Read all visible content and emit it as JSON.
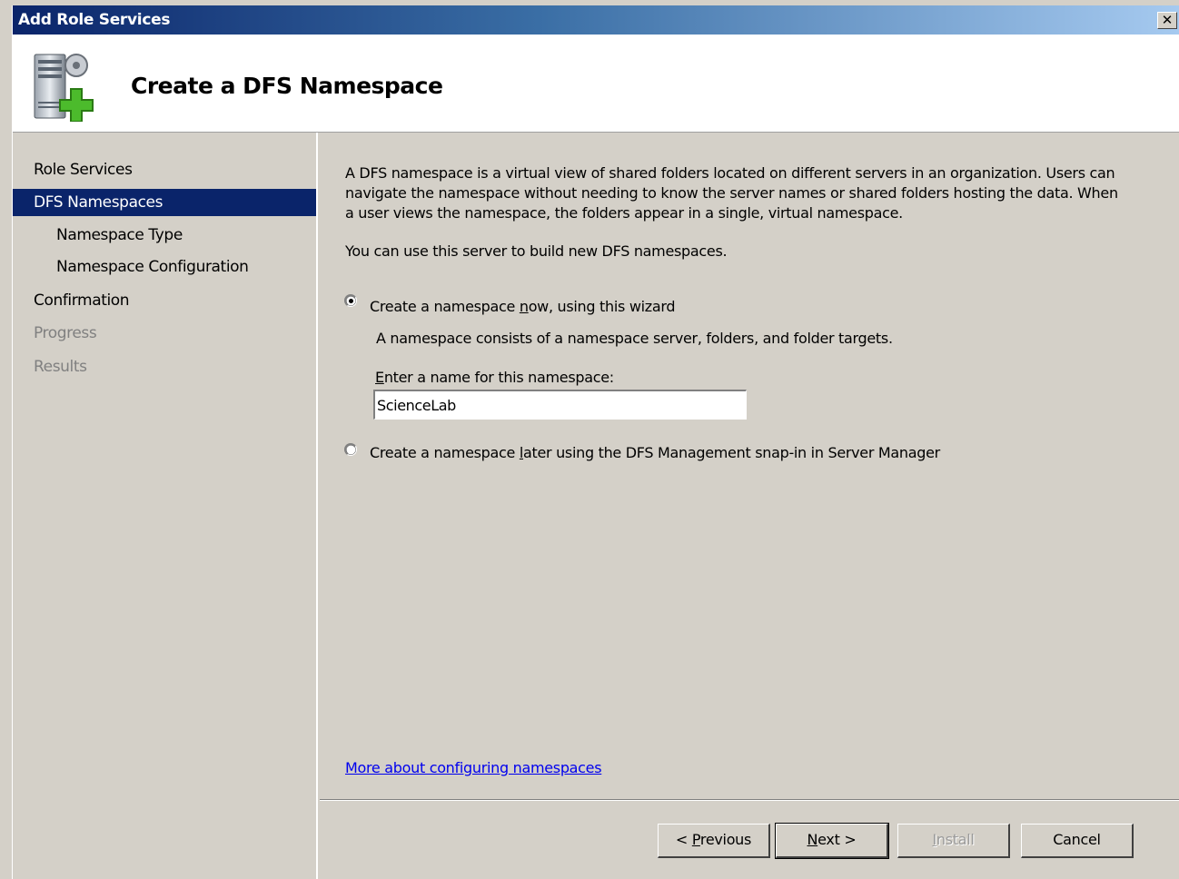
{
  "window": {
    "title": "Add Role Services",
    "close_label": "✕"
  },
  "header": {
    "title": "Create a DFS Namespace",
    "icon": "server-add-icon"
  },
  "nav": {
    "items": [
      {
        "label": "Role Services",
        "state": "normal",
        "level": 0
      },
      {
        "label": "DFS Namespaces",
        "state": "active",
        "level": 0
      },
      {
        "label": "Namespace Type",
        "state": "normal",
        "level": 1
      },
      {
        "label": "Namespace Configuration",
        "state": "normal",
        "level": 1
      },
      {
        "label": "Confirmation",
        "state": "normal",
        "level": 0
      },
      {
        "label": "Progress",
        "state": "disabled",
        "level": 0
      },
      {
        "label": "Results",
        "state": "disabled",
        "level": 0
      }
    ]
  },
  "content": {
    "intro_line1": "A DFS namespace is a virtual view of shared folders located on different servers in an organization. Users can",
    "intro_line2": "navigate the namespace without needing to know the server names or shared folders hosting the data. When",
    "intro_line3": "a user views the namespace, the folders appear in a single, virtual namespace.",
    "server_note": "You can use this server to build new DFS namespaces.",
    "option_now": {
      "pre": "Create a namespace ",
      "mnemonic": "n",
      "post": "ow, using this wizard",
      "selected": true
    },
    "option_now_desc": "A namespace consists of a namespace server, folders, and folder targets.",
    "name_label": {
      "mnemonic": "E",
      "post": "nter a name for this namespace:"
    },
    "name_value": "ScienceLab",
    "option_later": {
      "pre": "Create a namespace ",
      "mnemonic": "l",
      "post": "ater using the DFS Management snap-in in Server Manager",
      "selected": false
    },
    "more_link": "More about configuring namespaces"
  },
  "buttons": {
    "previous": {
      "pre": "< ",
      "mnemonic": "P",
      "post": "revious"
    },
    "next": {
      "pre": "",
      "mnemonic": "N",
      "post": "ext >"
    },
    "install": {
      "pre": "",
      "mnemonic": "I",
      "post": "nstall"
    },
    "cancel": "Cancel"
  }
}
